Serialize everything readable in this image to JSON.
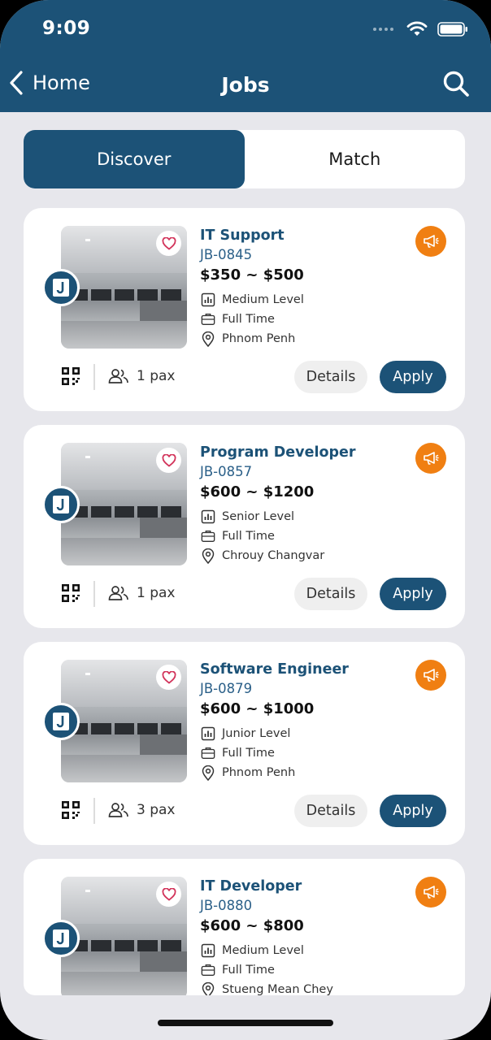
{
  "status_bar": {
    "time": "9:09"
  },
  "nav": {
    "back_label": "Home",
    "title": "Jobs"
  },
  "tabs": [
    {
      "label": "Discover",
      "active": true
    },
    {
      "label": "Match",
      "active": false
    }
  ],
  "jobs": [
    {
      "title": "IT Support",
      "code": "JB-0845",
      "salary": "$350 ~ $500",
      "level": "Medium Level",
      "type": "Full Time",
      "location": "Phnom Penh",
      "pax": "1 pax",
      "details_label": "Details",
      "apply_label": "Apply"
    },
    {
      "title": "Program Developer",
      "code": "JB-0857",
      "salary": "$600 ~ $1200",
      "level": "Senior Level",
      "type": "Full Time",
      "location": "Chrouy Changvar",
      "pax": "1 pax",
      "details_label": "Details",
      "apply_label": "Apply"
    },
    {
      "title": "Software Engineer",
      "code": "JB-0879",
      "salary": "$600 ~ $1000",
      "level": "Junior Level",
      "type": "Full Time",
      "location": "Phnom Penh",
      "pax": "3 pax",
      "details_label": "Details",
      "apply_label": "Apply"
    },
    {
      "title": "IT Developer",
      "code": "JB-0880",
      "salary": "$600 ~ $800",
      "level": "Medium Level",
      "type": "Full Time",
      "location": "Stueng Mean Chey"
    }
  ],
  "colors": {
    "brand": "#1c5277",
    "accent": "#f07f12",
    "favorite": "#d2335a",
    "background": "#e7e7ec"
  }
}
